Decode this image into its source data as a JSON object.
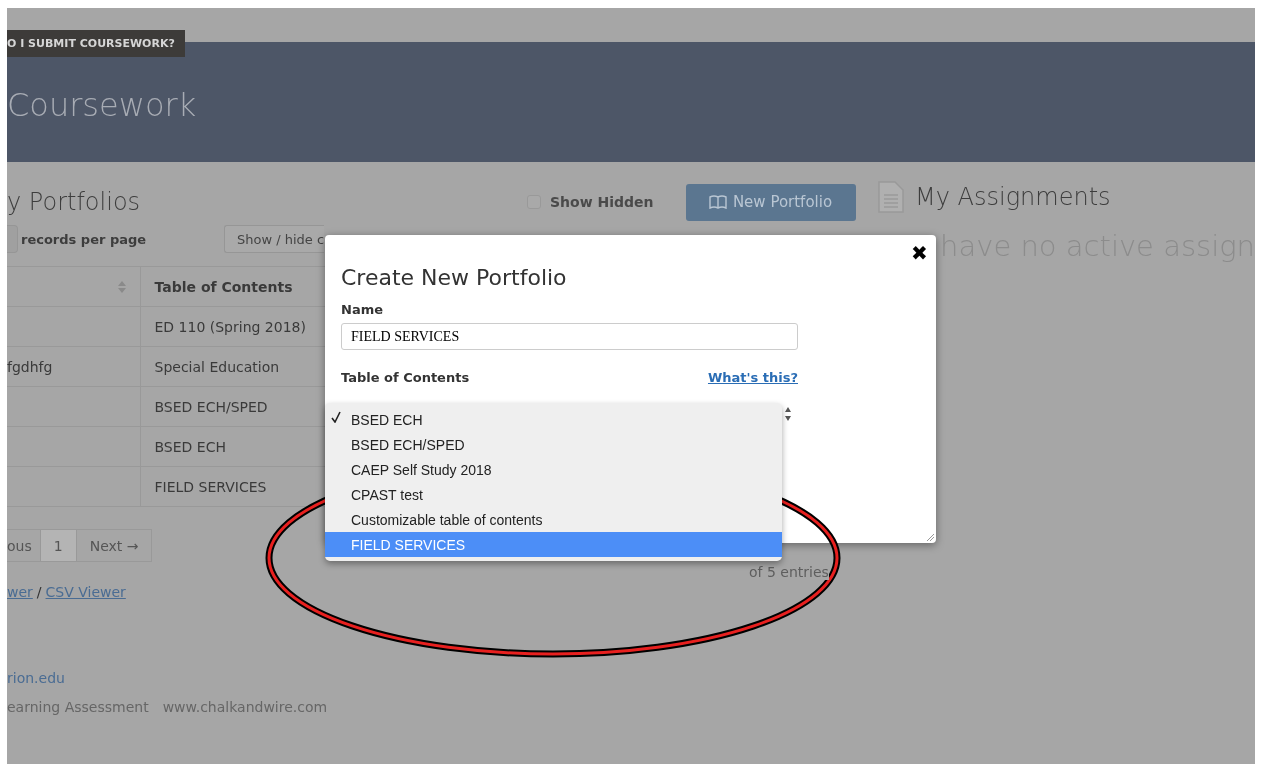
{
  "help_tab": {
    "label": "O I SUBMIT COURSEWORK?"
  },
  "header": {
    "title": "Coursework"
  },
  "portfolios": {
    "title": "y Portfolios",
    "show_hidden": {
      "label": "Show Hidden",
      "checked": false
    },
    "new_button": {
      "label": "New Portfolio"
    },
    "records_per_page": "records per page",
    "show_hide_button": "Show / hide c",
    "table": {
      "columns": [
        "Table of Contents"
      ],
      "rows": [
        {
          "table_of_contents": "ED 110 (Spring 2018)"
        },
        {
          "column_1": "fgdhfg",
          "table_of_contents": "Special Education"
        },
        {
          "table_of_contents": "BSED ECH/SPED"
        },
        {
          "table_of_contents": "BSED ECH"
        },
        {
          "table_of_contents": "FIELD SERVICES"
        }
      ]
    },
    "table_info": "of 5 entries",
    "pagination": {
      "previous": "ous",
      "page": "1",
      "next": "Next →"
    },
    "links": [
      {
        "label": "wer"
      },
      {
        "label": "CSV Viewer"
      }
    ],
    "link_separator": "/",
    "footer": {
      "email": "rion.edu",
      "text": "earning Assessment",
      "website": "www.chalkandwire.com"
    }
  },
  "assignments": {
    "title": "My Assignments",
    "message": "have no active assign"
  },
  "modal": {
    "title": "Create New Portfolio",
    "close": "✖",
    "name_label": "Name",
    "name_value": "FIELD SERVICES",
    "toc_label": "Table of Contents",
    "help_link": "What's this?",
    "options": [
      {
        "label": "BSED ECH",
        "checked": true,
        "selected": false
      },
      {
        "label": "BSED ECH/SPED",
        "checked": false,
        "selected": false
      },
      {
        "label": "CAEP Self Study 2018",
        "checked": false,
        "selected": false
      },
      {
        "label": "CPAST test",
        "checked": false,
        "selected": false
      },
      {
        "label": "Customizable table of contents",
        "checked": false,
        "selected": false
      },
      {
        "label": "FIELD SERVICES",
        "checked": false,
        "selected": true
      }
    ]
  }
}
